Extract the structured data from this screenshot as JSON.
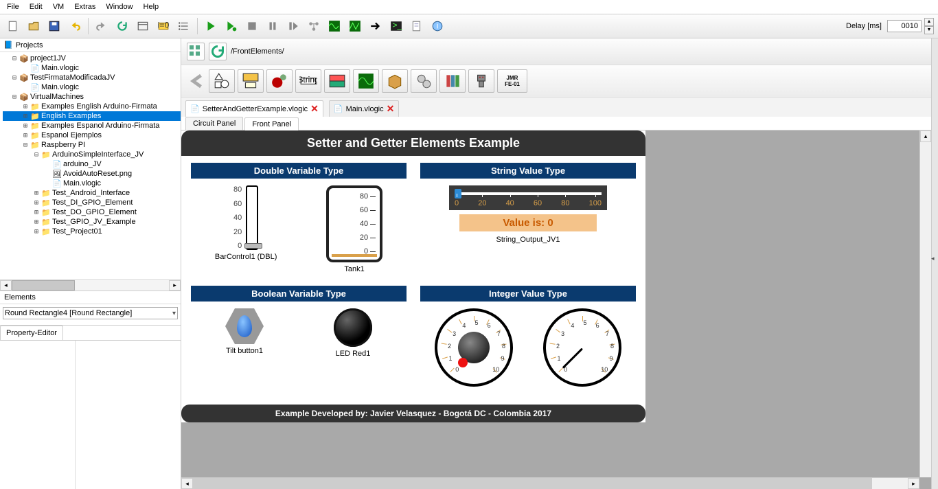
{
  "menu": [
    "File",
    "Edit",
    "VM",
    "Extras",
    "Window",
    "Help"
  ],
  "delay": {
    "label": "Delay [ms]",
    "value": "0010"
  },
  "breadcrumb": "/FrontElements/",
  "projects": {
    "header": "Projects"
  },
  "tree": [
    {
      "indent": 0,
      "toggle": "⊟",
      "icon": "pkg",
      "label": "project1JV"
    },
    {
      "indent": 1,
      "toggle": "",
      "icon": "file",
      "label": "Main.vlogic"
    },
    {
      "indent": 0,
      "toggle": "⊟",
      "icon": "pkg",
      "label": "TestFirmataModificadaJV"
    },
    {
      "indent": 1,
      "toggle": "",
      "icon": "file",
      "label": "Main.vlogic"
    },
    {
      "indent": 0,
      "toggle": "⊟",
      "icon": "pkg",
      "label": "VirtualMachines"
    },
    {
      "indent": 1,
      "toggle": "⊞",
      "icon": "folder",
      "label": "Examples English Arduino-Firmata"
    },
    {
      "indent": 1,
      "toggle": "⊞",
      "icon": "folder",
      "label": "English Examples",
      "selected": true
    },
    {
      "indent": 1,
      "toggle": "⊞",
      "icon": "folder",
      "label": "Examples Espanol Arduino-Firmata"
    },
    {
      "indent": 1,
      "toggle": "⊞",
      "icon": "folder",
      "label": "Espanol Ejemplos"
    },
    {
      "indent": 1,
      "toggle": "⊟",
      "icon": "folder",
      "label": "Raspberry PI"
    },
    {
      "indent": 2,
      "toggle": "⊟",
      "icon": "folder",
      "label": "ArduinoSimpleInterface_JV"
    },
    {
      "indent": 3,
      "toggle": "",
      "icon": "file",
      "label": "arduino_JV"
    },
    {
      "indent": 3,
      "toggle": "",
      "icon": "img",
      "label": "AvoidAutoReset.png"
    },
    {
      "indent": 3,
      "toggle": "",
      "icon": "file",
      "label": "Main.vlogic"
    },
    {
      "indent": 2,
      "toggle": "⊞",
      "icon": "folder",
      "label": "Test_Android_Interface"
    },
    {
      "indent": 2,
      "toggle": "⊞",
      "icon": "folder",
      "label": "Test_DI_GPIO_Element"
    },
    {
      "indent": 2,
      "toggle": "⊞",
      "icon": "folder",
      "label": "Test_DO_GPIO_Element"
    },
    {
      "indent": 2,
      "toggle": "⊞",
      "icon": "folder",
      "label": "Test_GPIO_JV_Example"
    },
    {
      "indent": 2,
      "toggle": "⊞",
      "icon": "folder",
      "label": "Test_Project01"
    }
  ],
  "elements": {
    "header": "Elements",
    "selected": "Round Rectangle4 [Round Rectangle]",
    "property_tab": "Property-Editor"
  },
  "file_tabs": [
    {
      "label": "SetterAndGetterExample.vlogic",
      "active": true
    },
    {
      "label": "Main.vlogic",
      "active": false
    }
  ],
  "panel_tabs": [
    {
      "label": "Circuit Panel",
      "active": false
    },
    {
      "label": "Front Panel",
      "active": true
    }
  ],
  "palette_jmr": "JMR\nFE-01",
  "front_panel": {
    "title": "Setter and Getter Elements Example",
    "footer": "Example Developed by: Javier Velasquez - Bogotá DC - Colombia 2017",
    "sections": {
      "double": {
        "header": "Double Variable Type",
        "bar_label": "BarControl1 (DBL)",
        "tank_label": "Tank1",
        "ticks": [
          "80",
          "60",
          "40",
          "20",
          "0"
        ]
      },
      "string": {
        "header": "String Value Type",
        "ticks": [
          "0",
          "20",
          "40",
          "60",
          "80",
          "100"
        ],
        "output_caption": "Value is: 0",
        "output_label": "String_Output_JV1"
      },
      "boolean": {
        "header": "Boolean Variable Type",
        "tilt_label": "Tilt button1",
        "led_label": "LED Red1"
      },
      "integer": {
        "header": "Integer Value Type",
        "ticks": [
          "0",
          "1",
          "2",
          "3",
          "4",
          "5",
          "6",
          "7",
          "8",
          "9",
          "10"
        ]
      }
    }
  }
}
